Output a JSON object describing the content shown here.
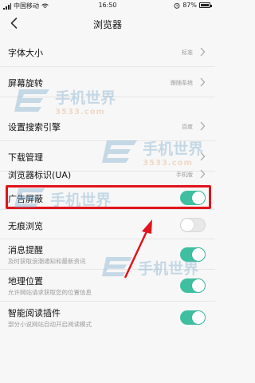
{
  "status_bar": {
    "carrier": "中国移动",
    "time": "16:50",
    "battery": "87%"
  },
  "nav": {
    "title": "浏览器",
    "back_icon": "chevron-left-icon"
  },
  "settings": [
    {
      "label": "字体大小",
      "value": "标准",
      "control": "chevron"
    },
    {
      "label": "屏幕旋转",
      "value": "跟随系统",
      "control": "chevron"
    },
    {
      "label": "设置搜索引擎",
      "value": "百度",
      "control": "chevron"
    },
    {
      "label": "下载管理",
      "value": "",
      "control": "chevron"
    },
    {
      "label": "浏览器标识(UA)",
      "value": "手机版",
      "control": "chevron"
    },
    {
      "label": "广告屏蔽",
      "control": "toggle",
      "toggle_on": true
    },
    {
      "label": "无痕浏览",
      "control": "toggle",
      "toggle_on": false
    },
    {
      "label": "消息提醒",
      "sub": "及时获取浪潮通知和最新资讯",
      "control": "toggle",
      "toggle_on": true
    },
    {
      "label": "地理位置",
      "sub": "允许网站请求获取您的位置信息",
      "control": "toggle",
      "toggle_on": true
    },
    {
      "label": "智能阅读插件",
      "sub": "部分小说网站自动开启阅读模式",
      "control": "toggle",
      "toggle_on": true
    }
  ],
  "watermark": {
    "text": "手机世界",
    "number": "3533.com"
  },
  "colors": {
    "toggle_on": "#3fbfa1",
    "highlight": "#e0141c",
    "arrow": "#e0141c"
  }
}
